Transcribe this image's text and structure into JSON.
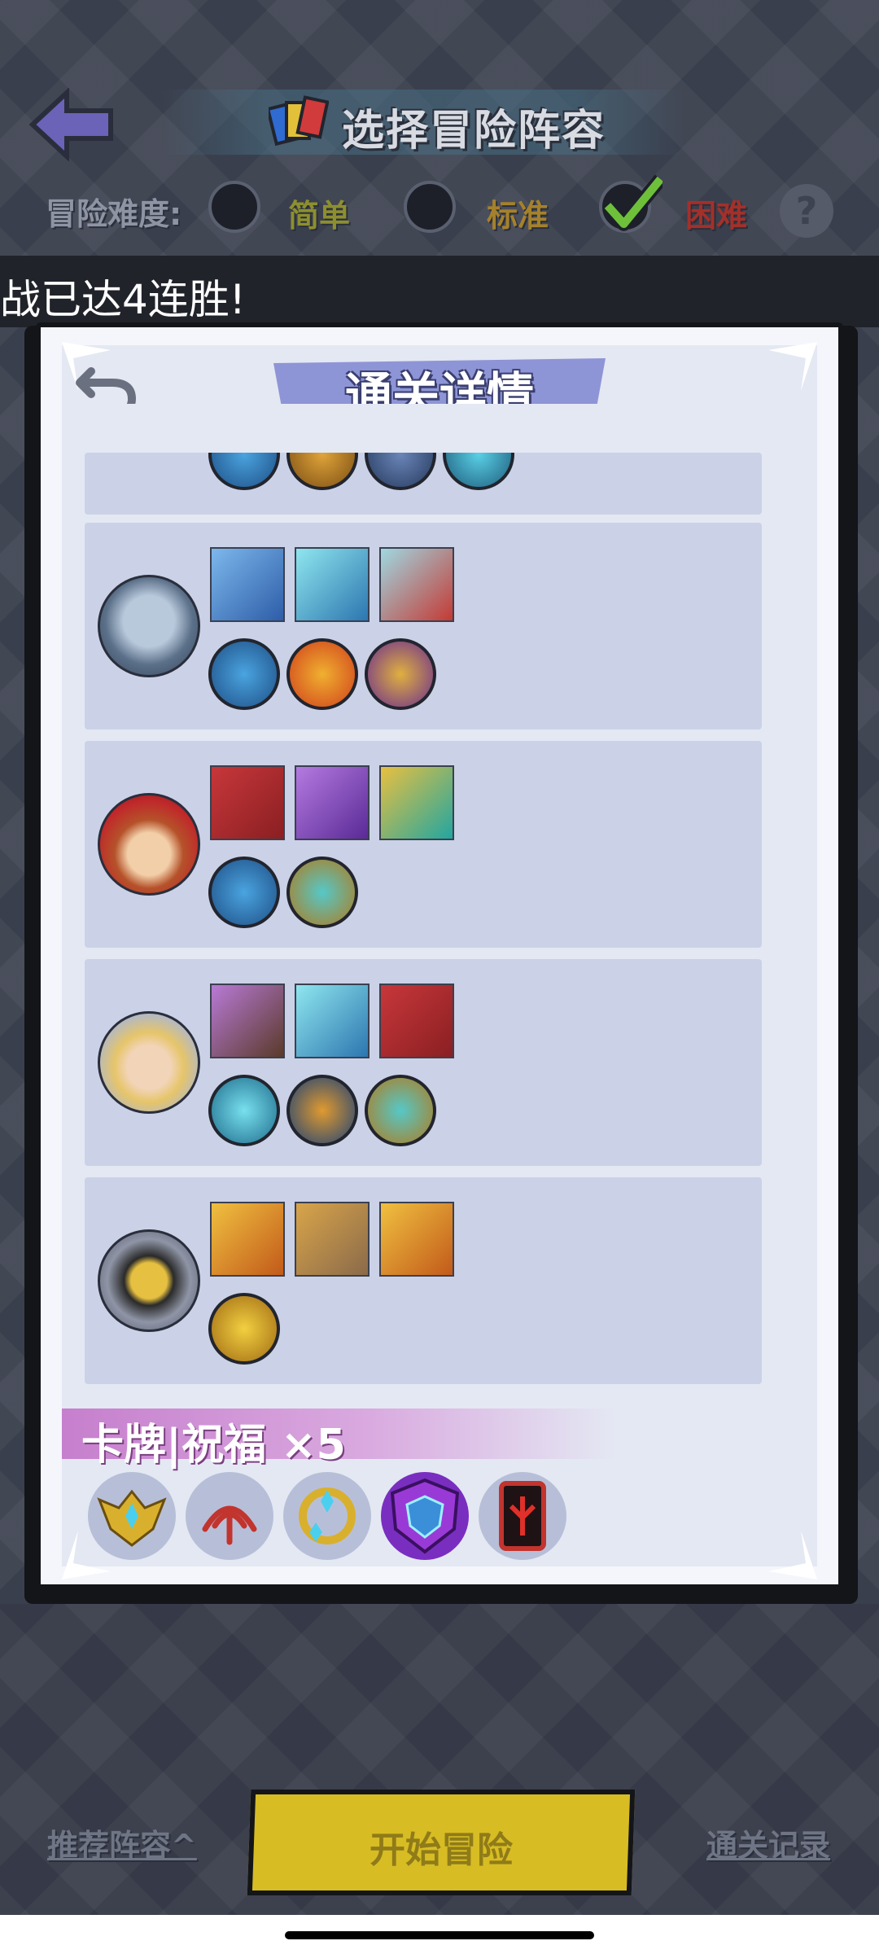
{
  "header": {
    "title": "选择冒险阵容",
    "difficulty_label": "冒险难度:",
    "options": [
      {
        "label": "简单",
        "color": "#8d8f2f",
        "selected": false
      },
      {
        "label": "标准",
        "color": "#a5812b",
        "selected": false
      },
      {
        "label": "困难",
        "color": "#a3302a",
        "selected": true
      }
    ],
    "help_icon": "?"
  },
  "marquee": {
    "text": "战已达4连胜!"
  },
  "modal": {
    "title": "通关详情",
    "blessing_label": "卡牌|祝福 ×5",
    "heroes": [
      {
        "name": "ice-spirit",
        "items": [
          "ice-crown-icon",
          "frost-shield-icon",
          "red-beast-icon"
        ],
        "runes": [
          "ice-crystal-rune",
          "fire-rune",
          "purple-gem-rune"
        ]
      },
      {
        "name": "red-hat-gunner",
        "items": [
          "cannon-icon",
          "purple-spear-icon",
          "ice-blade-icon"
        ],
        "runes": [
          "ice-crystal-rune",
          "wind-rune"
        ]
      },
      {
        "name": "blonde-mage",
        "items": [
          "dark-shield-icon",
          "frost-shield-icon",
          "cannon-icon"
        ],
        "runes": [
          "lightning-rune",
          "torch-rune",
          "wind-rune"
        ]
      },
      {
        "name": "golden-knight",
        "items": [
          "gold-helm-icon",
          "stone-armor-icon",
          "gold-helm-icon"
        ],
        "runes": [
          "gold-wing-rune"
        ]
      }
    ],
    "blessings": [
      "gold-wings-icon",
      "red-swirl-icon",
      "gold-orb-icon",
      "purple-shield-icon",
      "red-card-icon"
    ]
  },
  "bottom": {
    "recommend": "推荐阵容^",
    "start": "开始冒险",
    "record": "通关记录"
  }
}
